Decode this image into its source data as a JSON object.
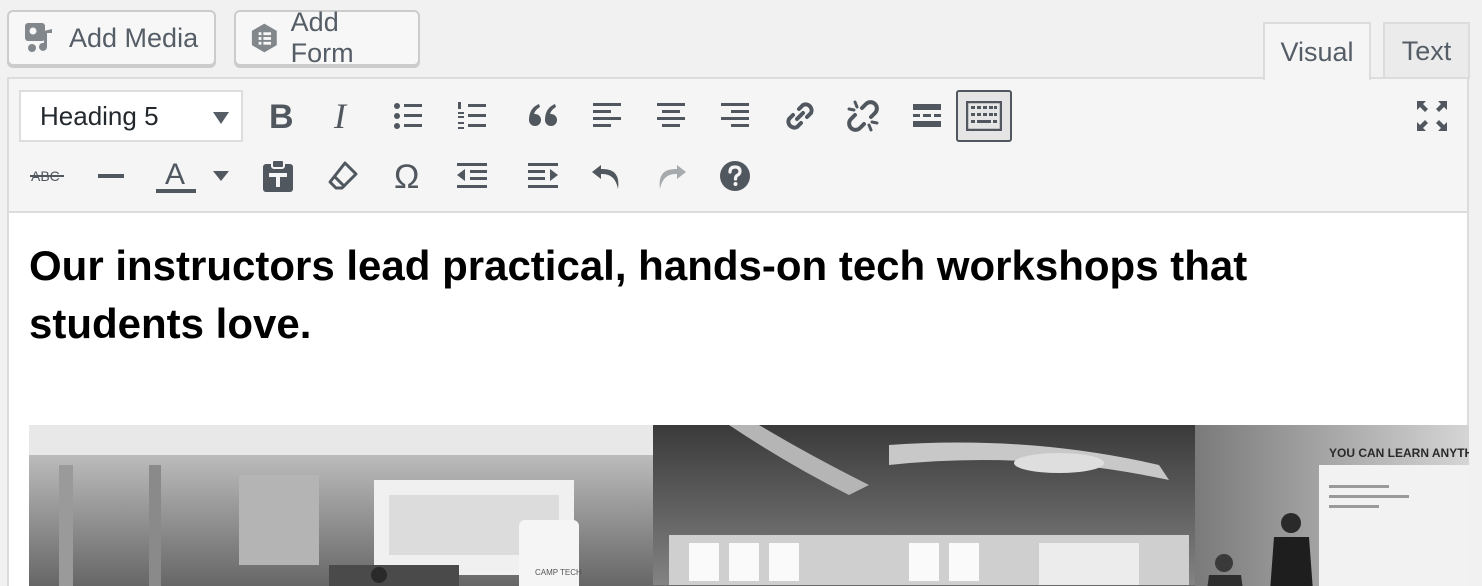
{
  "media_buttons": {
    "add_media_label": "Add Media",
    "add_form_label": "Add Form"
  },
  "tabs": {
    "visual_label": "Visual",
    "text_label": "Text",
    "active": "visual"
  },
  "toolbar": {
    "format_select_value": "Heading 5",
    "row1_icons": [
      "bold-icon",
      "italic-icon",
      "bulleted-list-icon",
      "numbered-list-icon",
      "blockquote-icon",
      "align-left-icon",
      "align-center-icon",
      "align-right-icon",
      "link-icon",
      "unlink-icon",
      "read-more-icon",
      "toolbar-toggle-icon",
      "fullscreen-icon"
    ],
    "row2_icons": [
      "strikethrough-icon",
      "horizontal-line-icon",
      "text-color-icon",
      "text-color-dropdown-icon",
      "paste-as-text-icon",
      "clear-formatting-icon",
      "special-character-icon",
      "outdent-icon",
      "indent-icon",
      "undo-icon",
      "redo-icon",
      "help-icon"
    ],
    "strikethrough_glyph": "ABC",
    "text_color_glyph": "A",
    "special_char_glyph": "Ω",
    "bold_glyph": "B",
    "italic_glyph": "I"
  },
  "content": {
    "heading_text": "Our instructors lead practical, hands-on tech workshops that students love.",
    "image_sign_text": "YOU CAN LEARN ANYTHING",
    "image_banner_text": "CAMP TECH"
  },
  "colors": {
    "icon": "#50575e",
    "disabled_icon": "#a7aaad",
    "toolbar_bg": "#f5f5f5",
    "editor_bg": "#ffffff"
  }
}
